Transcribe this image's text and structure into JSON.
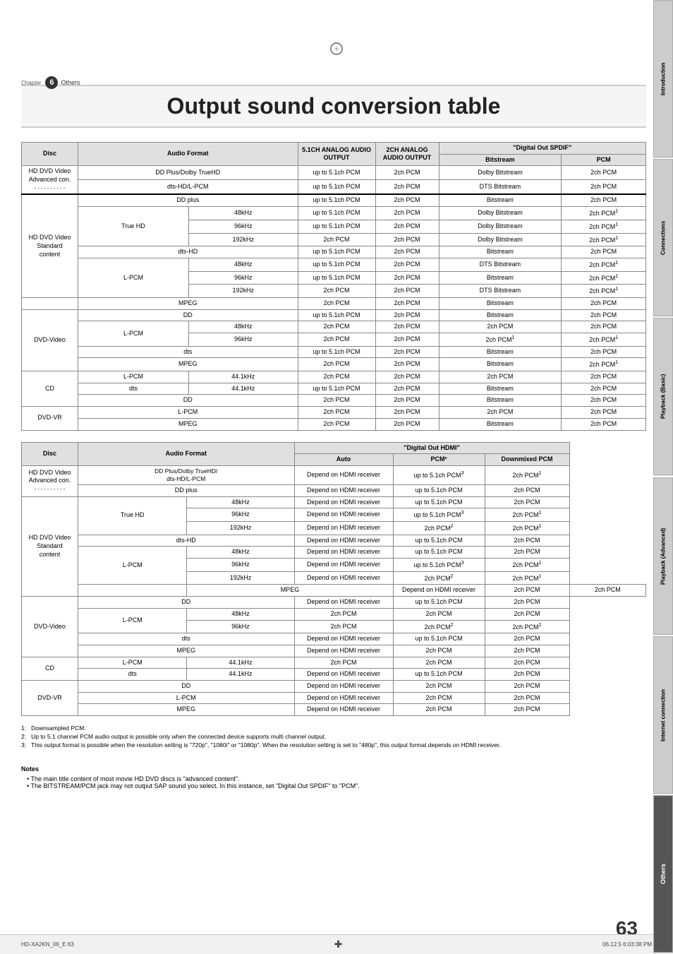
{
  "page": {
    "title": "Output sound conversion table",
    "chapter_number": "6",
    "chapter_label": "Others",
    "page_number": "63",
    "footer_left": "HD-XA2KN_06_E  63",
    "footer_right": "06.12.5  6:03:38 PM"
  },
  "sidebar_tabs": [
    {
      "label": "Introduction",
      "active": false
    },
    {
      "label": "Connections",
      "active": false
    },
    {
      "label": "Playback (Basic)",
      "active": false
    },
    {
      "label": "Playback (Advanced)",
      "active": false
    },
    {
      "label": "Internet connection",
      "active": false
    },
    {
      "label": "Others",
      "active": true
    }
  ],
  "table1": {
    "headers": {
      "disc": "Disc",
      "audio_format": "Audio Format",
      "analog5ch": "5.1CH ANALOG AUDIO OUTPUT",
      "analog2ch": "2CH ANALOG AUDIO OUTPUT",
      "digital_spdif": "\"Digital Out SPDIF\"",
      "bitstream": "Bitstream",
      "pcm": "PCM"
    },
    "rows": [
      {
        "disc": "HD DVD Video Advanced con.",
        "disc_rowspan": 2,
        "format": "DD Plus/Dolby TrueHD",
        "freq": "",
        "analog5ch": "up to 5.1ch PCM",
        "analog2ch": "2ch PCM",
        "bitstream": "Dolby Bitstream",
        "pcm": "2ch PCM"
      },
      {
        "disc": "",
        "format": "dts-HD/L-PCM",
        "freq": "",
        "analog5ch": "up to 5.1ch PCM",
        "analog2ch": "2ch PCM",
        "bitstream": "DTS Bitstream",
        "pcm": "2ch PCM"
      },
      {
        "disc": "",
        "format": "DD plus",
        "freq": "",
        "analog5ch": "up to 5.1ch PCM",
        "analog2ch": "2ch PCM",
        "bitstream": "Bitstream",
        "pcm": "2ch PCM"
      },
      {
        "disc": "HD DVD Video Standard content",
        "disc_rowspan": 8,
        "format": "True HD",
        "freq": "48kHz",
        "analog5ch": "up to 5.1ch PCM",
        "analog2ch": "2ch PCM",
        "bitstream": "Dolby Bitstream",
        "pcm": "2ch PCM¹"
      },
      {
        "disc": "",
        "format": "",
        "freq": "96kHz",
        "analog5ch": "up to 5.1ch PCM",
        "analog2ch": "2ch PCM",
        "bitstream": "Dolby Bitstream",
        "pcm": "2ch PCM¹"
      },
      {
        "disc": "",
        "format": "",
        "freq": "192kHz",
        "analog5ch": "2ch PCM",
        "analog2ch": "2ch PCM",
        "bitstream": "Dolby Bitstream",
        "pcm": "2ch PCM¹"
      },
      {
        "disc": "",
        "format": "dts-HD",
        "freq": "",
        "analog5ch": "up to 5.1ch PCM",
        "analog2ch": "2ch PCM",
        "bitstream": "Bitstream",
        "pcm": "2ch PCM"
      },
      {
        "disc": "",
        "format": "L-PCM",
        "freq": "48kHz",
        "analog5ch": "up to 5.1ch PCM",
        "analog2ch": "2ch PCM",
        "bitstream": "DTS Bitstream",
        "pcm": "2ch PCM¹"
      },
      {
        "disc": "",
        "format": "",
        "freq": "96kHz",
        "analog5ch": "up to 5.1ch PCM",
        "analog2ch": "2ch PCM",
        "bitstream": "Bitstream",
        "pcm": "2ch PCM¹"
      },
      {
        "disc": "",
        "format": "",
        "freq": "192kHz",
        "analog5ch": "2ch PCM",
        "analog2ch": "2ch PCM",
        "bitstream": "DTS Bitstream",
        "pcm": "2ch PCM¹"
      },
      {
        "disc": "",
        "format": "MPEG",
        "freq": "",
        "analog5ch": "2ch PCM",
        "analog2ch": "2ch PCM",
        "bitstream": "Bitstream",
        "pcm": "2ch PCM"
      },
      {
        "disc": "DVD-Video",
        "disc_rowspan": 6,
        "format": "DD",
        "freq": "",
        "analog5ch": "up to 5.1ch PCM",
        "analog2ch": "2ch PCM",
        "bitstream": "Bitstream",
        "pcm": "2ch PCM"
      },
      {
        "disc": "",
        "format": "L-PCM",
        "freq": "48kHz",
        "analog5ch": "2ch PCM",
        "analog2ch": "2ch PCM",
        "bitstream": "2ch PCM",
        "pcm": "2ch PCM"
      },
      {
        "disc": "",
        "format": "",
        "freq": "96kHz",
        "analog5ch": "2ch PCM",
        "analog2ch": "2ch PCM",
        "bitstream": "2ch PCM¹",
        "pcm": "2ch PCM¹"
      },
      {
        "disc": "",
        "format": "dts",
        "freq": "",
        "analog5ch": "up to 5.1ch PCM",
        "analog2ch": "2ch PCM",
        "bitstream": "Bitstream",
        "pcm": "2ch PCM"
      },
      {
        "disc": "",
        "format": "MPEG",
        "freq": "",
        "analog5ch": "2ch PCM",
        "analog2ch": "2ch PCM",
        "bitstream": "Bitstream",
        "pcm": "2ch PCM¹"
      },
      {
        "disc": "CD",
        "disc_rowspan": 3,
        "format": "L-PCM",
        "freq": "44.1kHz",
        "analog5ch": "2ch PCM",
        "analog2ch": "2ch PCM",
        "bitstream": "2ch PCM",
        "pcm": "2ch PCM"
      },
      {
        "disc": "",
        "format": "dts",
        "freq": "44.1kHz",
        "analog5ch": "up to 5.1ch PCM",
        "analog2ch": "2ch PCM",
        "bitstream": "Bitstream",
        "pcm": "2ch PCM"
      },
      {
        "disc": "",
        "format": "DD",
        "freq": "",
        "analog5ch": "2ch PCM",
        "analog2ch": "2ch PCM",
        "bitstream": "Bitstream",
        "pcm": "2ch PCM"
      },
      {
        "disc": "DVD-VR",
        "disc_rowspan": 2,
        "format": "L-PCM",
        "freq": "",
        "analog5ch": "2ch PCM",
        "analog2ch": "2ch PCM",
        "bitstream": "2ch PCM",
        "pcm": "2ch PCM"
      },
      {
        "disc": "",
        "format": "MPEG",
        "freq": "",
        "analog5ch": "2ch PCM",
        "analog2ch": "2ch PCM",
        "bitstream": "Bitstream",
        "pcm": "2ch PCM"
      }
    ]
  },
  "table2": {
    "headers": {
      "disc": "Disc",
      "audio_format": "Audio Format",
      "digital_hdmi": "\"Digital Out HDMI\"",
      "auto": "Auto",
      "pcm": "PCM²",
      "downmixed": "Downmixed PCM"
    },
    "rows": [
      {
        "disc": "HD DVD Video Advanced con.",
        "disc_rowspan": 2,
        "format": "DD Plus/Dolby TrueHD/ dts-HD/L-PCM",
        "freq": "",
        "auto": "Depend on HDMI receiver",
        "pcm": "up to 5.1ch PCM³",
        "downmixed": "2ch PCM¹"
      },
      {
        "disc": "",
        "format": "DD plus",
        "freq": "",
        "auto": "Depend on HDMI receiver",
        "pcm": "up to 5.1ch PCM",
        "downmixed": "2ch PCM"
      },
      {
        "disc": "HD DVD Video Standard content",
        "disc_rowspan": 8,
        "format": "True HD",
        "freq": "48kHz",
        "auto": "Depend on HDMI receiver",
        "pcm": "up to 5.1ch PCM",
        "downmixed": "2ch PCM"
      },
      {
        "disc": "",
        "format": "",
        "freq": "96kHz",
        "auto": "Depend on HDMI receiver",
        "pcm": "up to 5.1ch PCM³",
        "downmixed": "2ch PCM¹"
      },
      {
        "disc": "",
        "format": "",
        "freq": "192kHz",
        "auto": "Depend on HDMI receiver",
        "pcm": "2ch PCM²",
        "downmixed": "2ch PCM¹"
      },
      {
        "disc": "",
        "format": "dts-HD",
        "freq": "",
        "auto": "Depend on HDMI receiver",
        "pcm": "up to 5.1ch PCM",
        "downmixed": "2ch PCM"
      },
      {
        "disc": "",
        "format": "L-PCM",
        "freq": "48kHz",
        "auto": "Depend on HDMI receiver",
        "pcm": "up to 5.1ch PCM",
        "downmixed": "2ch PCM"
      },
      {
        "disc": "",
        "format": "",
        "freq": "96kHz",
        "auto": "Depend on HDMI receiver",
        "pcm": "up to 5.1ch PCM³",
        "downmixed": "2ch PCM¹"
      },
      {
        "disc": "",
        "format": "",
        "freq": "192kHz",
        "auto": "Depend on HDMI receiver",
        "pcm": "2ch PCM²",
        "downmixed": "2ch PCM¹"
      },
      {
        "disc": "",
        "format": "MPEG",
        "freq": "",
        "auto": "Depend on HDMI receiver",
        "pcm": "2ch PCM",
        "downmixed": "2ch PCM"
      },
      {
        "disc": "DVD-Video",
        "disc_rowspan": 5,
        "format": "DD",
        "freq": "",
        "auto": "Depend on HDMI receiver",
        "pcm": "up to 5.1ch PCM",
        "downmixed": "2ch PCM"
      },
      {
        "disc": "",
        "format": "L-PCM",
        "freq": "48kHz",
        "auto": "2ch PCM",
        "pcm": "2ch PCM",
        "downmixed": "2ch PCM"
      },
      {
        "disc": "",
        "format": "",
        "freq": "96kHz",
        "auto": "2ch PCM",
        "pcm": "2ch PCM²",
        "downmixed": "2ch PCM¹"
      },
      {
        "disc": "",
        "format": "dts",
        "freq": "",
        "auto": "Depend on HDMI receiver",
        "pcm": "up to 5.1ch PCM",
        "downmixed": "2ch PCM"
      },
      {
        "disc": "",
        "format": "MPEG",
        "freq": "",
        "auto": "Depend on HDMI receiver",
        "pcm": "2ch PCM",
        "downmixed": "2ch PCM"
      },
      {
        "disc": "CD",
        "disc_rowspan": 2,
        "format": "L-PCM",
        "freq": "44.1kHz",
        "auto": "2ch PCM",
        "pcm": "2ch PCM",
        "downmixed": "2ch PCM"
      },
      {
        "disc": "",
        "format": "dts",
        "freq": "44.1kHz",
        "auto": "Depend on HDMI receiver",
        "pcm": "up to 5.1ch PCM",
        "downmixed": "2ch PCM"
      },
      {
        "disc": "DVD-VR",
        "disc_rowspan": 3,
        "format": "DD",
        "freq": "",
        "auto": "Depend on HDMI receiver",
        "pcm": "2ch PCM",
        "downmixed": "2ch PCM"
      },
      {
        "disc": "",
        "format": "L-PCM",
        "freq": "",
        "auto": "Depend on HDMI receiver",
        "pcm": "2ch PCM",
        "downmixed": "2ch PCM"
      },
      {
        "disc": "",
        "format": "MPEG",
        "freq": "",
        "auto": "Depend on HDMI receiver",
        "pcm": "2ch PCM",
        "downmixed": "2ch PCM"
      }
    ]
  },
  "footnotes": [
    "1:  Downsampled PCM.",
    "2:  Up to 5.1 channel PCM audio output is possible only when the connected device supports multi channel output.",
    "3:  This output format is possible when the resolution setting is \"720p\", \"1080i\" or \"1080p\". When the resolution setting is set to \"480p\", this output format depends on HDMI receiver."
  ],
  "notes": {
    "title": "Notes",
    "items": [
      "The main title content of most movie HD DVD discs is \"advanced content\".",
      "The BITSTREAM/PCM jack may not output SAP sound you select. In this instance, set \"Digital Out SPDIF\" to \"PCM\"."
    ]
  }
}
